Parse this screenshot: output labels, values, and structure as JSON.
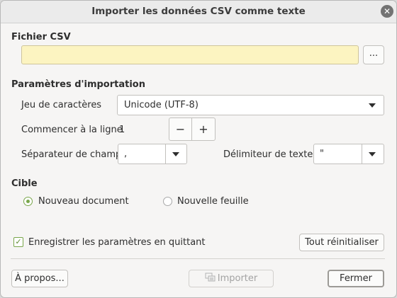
{
  "window": {
    "title": "Importer les données CSV comme texte"
  },
  "file_section": {
    "heading": "Fichier CSV",
    "path_value": "",
    "browse_label": "..."
  },
  "params": {
    "heading": "Paramètres d'importation",
    "charset_label": "Jeu de caractères",
    "charset_value": "Unicode (UTF-8)",
    "start_line_label": "Commencer à la ligne",
    "start_line_value": "1",
    "minus_label": "−",
    "plus_label": "+",
    "field_sep_label": "Séparateur de champ",
    "field_sep_value": ",",
    "text_delim_label": "Délimiteur de texte",
    "text_delim_value": "\""
  },
  "target": {
    "heading": "Cible",
    "new_document_label": "Nouveau document",
    "new_document_selected": true,
    "new_sheet_label": "Nouvelle feuille",
    "new_sheet_selected": false
  },
  "options": {
    "save_settings_label": "Enregistrer les paramètres en quittant",
    "save_settings_checked": true,
    "reset_label": "Tout réinitialiser"
  },
  "footer": {
    "about_label": "À propos...",
    "import_label": "Importer",
    "import_enabled": false,
    "close_label": "Fermer"
  },
  "icons": {
    "close": "close-icon",
    "import": "import-icon",
    "dropdown": "chevron-down-icon"
  }
}
